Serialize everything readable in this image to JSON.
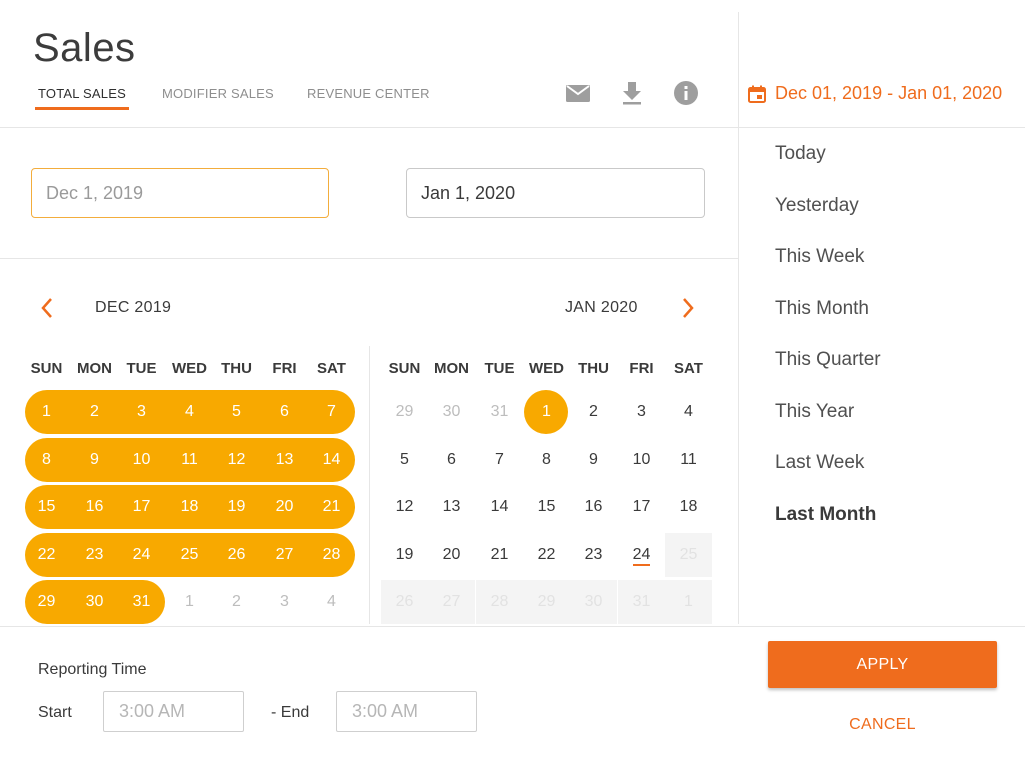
{
  "header": {
    "title": "Sales",
    "tabs": [
      {
        "label": "TOTAL SALES",
        "active": true
      },
      {
        "label": "MODIFIER SALES",
        "active": false
      },
      {
        "label": "REVENUE CENTER",
        "active": false
      }
    ],
    "icons": [
      "email-icon",
      "download-icon",
      "info-icon"
    ],
    "date_range": "Dec 01, 2019 - Jan 01, 2020"
  },
  "inputs": {
    "start_placeholder": "Dec 1, 2019",
    "end_value": "Jan 1, 2020"
  },
  "calendar": {
    "weekdays": [
      "SUN",
      "MON",
      "TUE",
      "WED",
      "THU",
      "FRI",
      "SAT"
    ],
    "left": {
      "label": "DEC 2019",
      "weeks": [
        [
          "1",
          "2",
          "3",
          "4",
          "5",
          "6",
          "7"
        ],
        [
          "8",
          "9",
          "10",
          "11",
          "12",
          "13",
          "14"
        ],
        [
          "15",
          "16",
          "17",
          "18",
          "19",
          "20",
          "21"
        ],
        [
          "22",
          "23",
          "24",
          "25",
          "26",
          "27",
          "28"
        ],
        [
          "29",
          "30",
          "31",
          "1",
          "2",
          "3",
          "4"
        ]
      ]
    },
    "right": {
      "label": "JAN 2020",
      "weeks": [
        [
          "29",
          "30",
          "31",
          "1",
          "2",
          "3",
          "4"
        ],
        [
          "5",
          "6",
          "7",
          "8",
          "9",
          "10",
          "11"
        ],
        [
          "12",
          "13",
          "14",
          "15",
          "16",
          "17",
          "18"
        ],
        [
          "19",
          "20",
          "21",
          "22",
          "23",
          "24",
          "25"
        ],
        [
          "26",
          "27",
          "28",
          "29",
          "30",
          "31",
          "1"
        ]
      ]
    }
  },
  "presets": {
    "items": [
      "Today",
      "Yesterday",
      "This Week",
      "This Month",
      "This Quarter",
      "This Year",
      "Last Week",
      "Last Month"
    ],
    "active": "Last Month"
  },
  "reporting": {
    "title": "Reporting Time",
    "start_label": "Start",
    "end_label": "- End",
    "start_placeholder": "3:00 AM",
    "end_placeholder": "3:00 AM"
  },
  "actions": {
    "apply": "APPLY",
    "cancel": "CANCEL"
  },
  "colors": {
    "accent": "#ef6c1d",
    "selection": "#f8a900"
  }
}
